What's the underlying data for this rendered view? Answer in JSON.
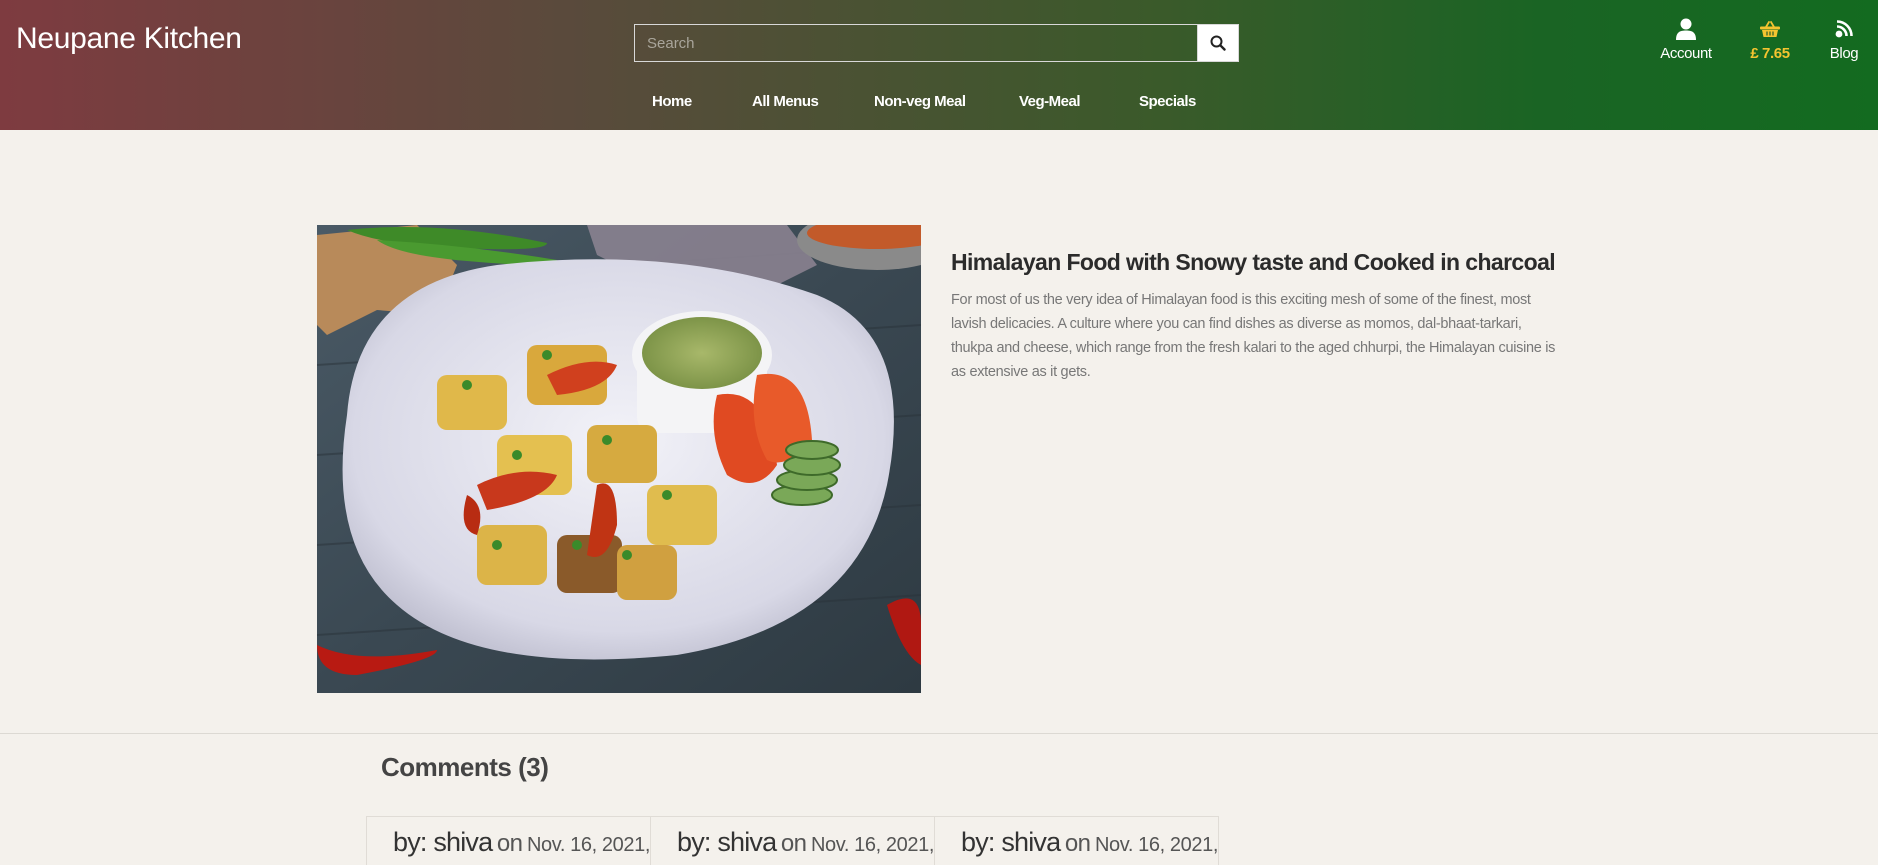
{
  "header": {
    "brand": "Neupane Kitchen",
    "search": {
      "placeholder": "Search",
      "button_icon": "search-icon"
    },
    "nav": [
      {
        "label": "Home"
      },
      {
        "label": "All Menus"
      },
      {
        "label": "Non-veg Meal"
      },
      {
        "label": "Veg-Meal"
      },
      {
        "label": "Specials"
      }
    ],
    "actions": {
      "account": {
        "label": "Account",
        "icon": "user-icon"
      },
      "cart": {
        "label": "£ 7.65",
        "icon": "basket-icon"
      },
      "blog": {
        "label": "Blog",
        "icon": "blog-icon"
      }
    }
  },
  "article": {
    "title": "Himalayan Food with Snowy taste and Cooked in charcoal",
    "body": "For most of us the very idea of Himalayan food is this exciting mesh of some of the finest, most lavish delicacies. A culture where you can find dishes as diverse as momos, dal-bhaat-tarkari, thukpa and cheese, which range from the fresh kalari to the aged chhurpi, the Himalayan cuisine is as extensive as it gets."
  },
  "comments": {
    "title": "Comments (3)",
    "items": [
      {
        "by": "by: shiva",
        "on": "on",
        "date": "Nov. 16, 2021,"
      },
      {
        "by": "by: shiva",
        "on": "on",
        "date": "Nov. 16, 2021,"
      },
      {
        "by": "by: shiva",
        "on": "on",
        "date": "Nov. 16, 2021,"
      }
    ]
  },
  "colors": {
    "accent_cart": "#f4c430",
    "page_bg": "#f4f1ec"
  }
}
